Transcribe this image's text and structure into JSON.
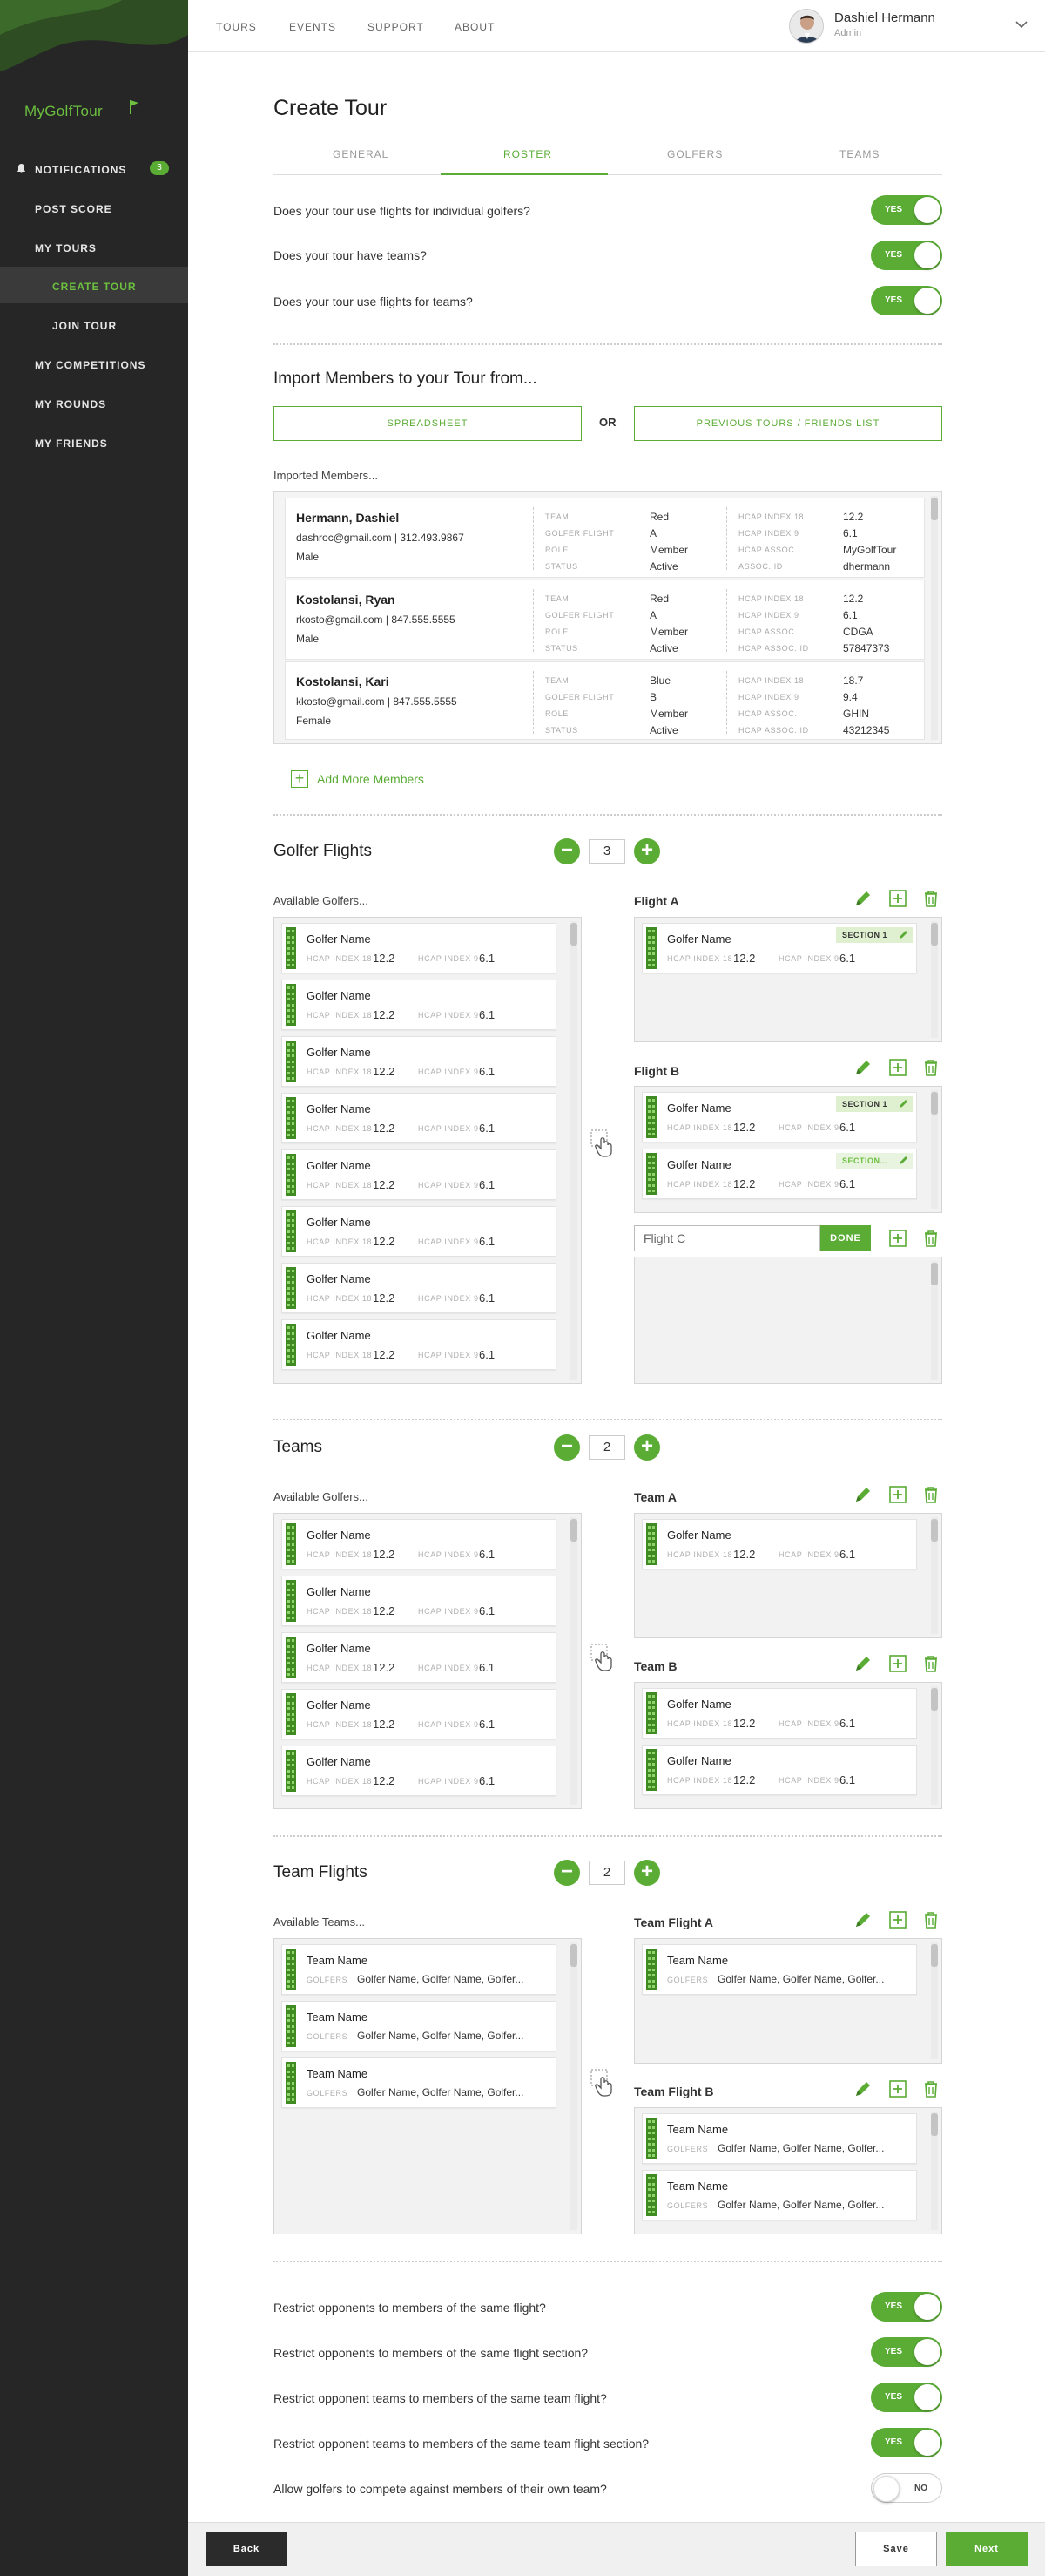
{
  "brand": "MyGolfTour",
  "sidebar": {
    "items": [
      {
        "label": "Notifications",
        "badge": "3"
      },
      {
        "label": "Post Score"
      },
      {
        "label": "My Tours"
      },
      {
        "label": "Create Tour"
      },
      {
        "label": "Join Tour"
      },
      {
        "label": "My Competitions"
      },
      {
        "label": "My Rounds"
      },
      {
        "label": "My Friends"
      }
    ]
  },
  "header": {
    "links": [
      "Tours",
      "Events",
      "Support",
      "About"
    ],
    "user_name": "Dashiel Hermann",
    "user_role": "Admin"
  },
  "page_title": "Create Tour",
  "tabs": [
    "General",
    "Roster",
    "Golfers",
    "Teams"
  ],
  "active_tab": "Roster",
  "questions_top": [
    {
      "text": "Does your tour use flights for individual golfers?",
      "toggle": "YES"
    },
    {
      "text": "Does your tour have teams?",
      "toggle": "YES"
    },
    {
      "text": "Does your tour use flights for teams?",
      "toggle": "YES"
    }
  ],
  "import": {
    "title": "Import Members to your Tour from...",
    "spreadsheet_button": "Spreadsheet",
    "or_label": "OR",
    "previous_button": "Previous Tours / Friends List",
    "imported_label": "Imported Members...",
    "add_more_label": "Add More Members"
  },
  "member_field_labels": [
    "Team",
    "Golfer Flight",
    "Role",
    "Status"
  ],
  "member_hcap_labels": [
    "HCAP Index 18",
    "HCAP Index 9",
    "HCAP Assoc.",
    "Assoc. ID"
  ],
  "member_hcap_labels_alt": [
    "HCAP Index 18",
    "HCAP Index 9",
    "HCAP Assoc.",
    "HCAP Assoc. ID"
  ],
  "members": [
    {
      "name": "Hermann, Dashiel",
      "contact": "dashroc@gmail.com  |  312.493.9867",
      "gender": "Male",
      "team": "Red",
      "flight": "A",
      "role": "Member",
      "status": "Active",
      "hcap18": "12.2",
      "hcap9": "6.1",
      "assoc": "MyGolfTour",
      "assoc_id": "dhermann"
    },
    {
      "name": "Kostolansi, Ryan",
      "contact": "rkosto@gmail.com  |  847.555.5555",
      "gender": "Male",
      "team": "Red",
      "flight": "A",
      "role": "Member",
      "status": "Active",
      "hcap18": "12.2",
      "hcap9": "6.1",
      "assoc": "CDGA",
      "assoc_id": "57847373"
    },
    {
      "name": "Kostolansi, Kari",
      "contact": "kkosto@gmail.com  |  847.555.5555",
      "gender": "Female",
      "team": "Blue",
      "flight": "B",
      "role": "Member",
      "status": "Active",
      "hcap18": "18.7",
      "hcap9": "9.4",
      "assoc": "GHIN",
      "assoc_id": "43212345"
    }
  ],
  "golfer_card": {
    "name": "Golfer Name",
    "label18": "HCAP Index 18",
    "val18": "12.2",
    "label9": "HCAP Index 9",
    "val9": "6.1"
  },
  "team_card": {
    "name": "Team Name",
    "label": "Golfers",
    "value": "Golfer Name, Golfer Name, Golfer..."
  },
  "golfer_flights": {
    "title": "Golfer Flights",
    "count": "3",
    "available_label": "Available Golfers...",
    "flights": [
      "Flight A",
      "Flight B"
    ],
    "section_tags": [
      "SECTION 1",
      "SECTION 1",
      "SECTION..."
    ],
    "new_flight_value": "Flight C",
    "done_label": "DONE"
  },
  "teams": {
    "title": "Teams",
    "count": "2",
    "available_label": "Available Golfers...",
    "teams": [
      "Team A",
      "Team B"
    ]
  },
  "team_flights": {
    "title": "Team Flights",
    "count": "2",
    "available_label": "Available Teams...",
    "flights": [
      "Team Flight A",
      "Team Flight B"
    ]
  },
  "questions_bottom": [
    {
      "text": "Restrict opponents to members of the same flight?",
      "toggle": "YES",
      "on": true
    },
    {
      "text": "Restrict opponents to members of the same flight section?",
      "toggle": "YES",
      "on": true
    },
    {
      "text": "Restrict opponent teams to members of the same team flight?",
      "toggle": "YES",
      "on": true
    },
    {
      "text": "Restrict opponent teams to members of the same team flight section?",
      "toggle": "YES",
      "on": true
    },
    {
      "text": "Allow golfers to compete against members of their own team?",
      "toggle": "NO",
      "on": false
    }
  ],
  "footer": {
    "back": "Back",
    "save": "Save",
    "next": "Next"
  },
  "colors": {
    "accent": "#5aac35",
    "sidebar": "#262626",
    "panel": "#f2f2f2"
  }
}
